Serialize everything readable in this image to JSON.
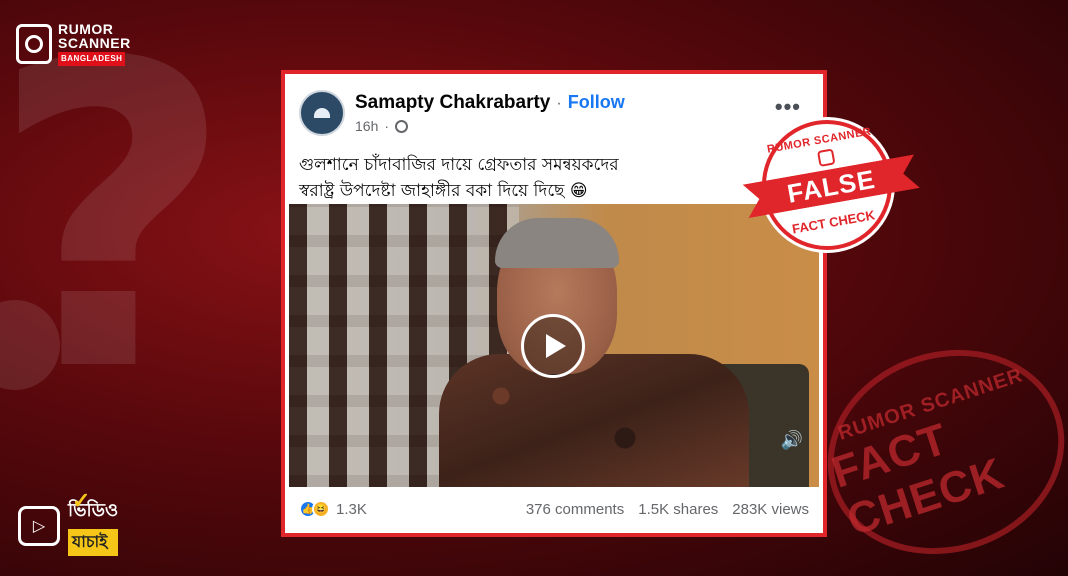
{
  "brand": {
    "line1": "RUMOR",
    "line2": "SCANNER",
    "line3": "BANGLADESH"
  },
  "video_badge": {
    "line1": "ভিডিও",
    "line2": "যাচাই"
  },
  "post": {
    "author": "Samapty Chakrabarty",
    "follow_label": "Follow",
    "time": "16h",
    "text_line1": "গুলশানে চাঁদাবাজির দায়ে গ্রেফতার সমন্বয়কদের",
    "text_line2": "স্বরাষ্ট্র উপদেষ্টা জাহাঙ্গীর বকা দিয়ে দিছে 😁",
    "reaction_count": "1.3K",
    "comments": "376 comments",
    "shares": "1.5K shares",
    "views": "283K views"
  },
  "stamp": {
    "top": "RUMOR SCANNER",
    "verdict": "FALSE",
    "bottom": "FACT CHECK"
  },
  "big_stamp": {
    "top": "RUMOR SCANNER",
    "bottom": "FACT CHECK"
  },
  "colors": {
    "accent_red": "#e0262a",
    "facebook_blue": "#1877f2",
    "badge_yellow": "#f5c518"
  }
}
